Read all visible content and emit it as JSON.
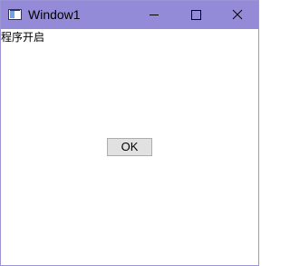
{
  "window": {
    "title": "Window1",
    "controls": {
      "minimize": "minimize-icon",
      "maximize": "maximize-icon",
      "close": "close-icon"
    }
  },
  "content": {
    "status_text": "程序开启",
    "ok_button_label": "OK"
  },
  "colors": {
    "titlebar": "#948bd8",
    "border": "#9b94d6",
    "button_bg": "#e1e1e1",
    "button_border": "#adadad"
  }
}
